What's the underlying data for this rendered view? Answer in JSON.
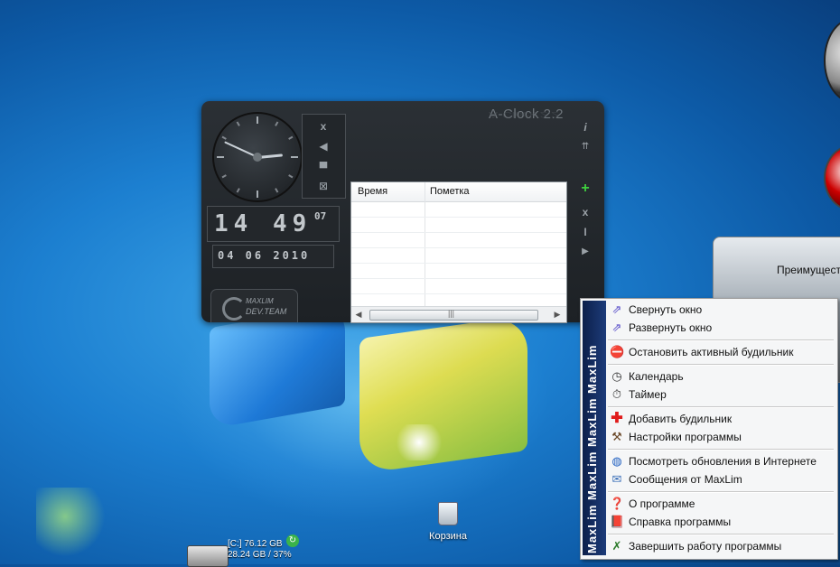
{
  "desktop": {
    "recycle_bin_label": "Корзина",
    "drive_line1": "[C:] 76.12 GB",
    "drive_line2": "28.24 GB / 37%",
    "promo_text": "Преимущест"
  },
  "aclock": {
    "title": "A-Clock 2.2",
    "analog": {
      "hour": 14,
      "minute": 49,
      "second": 7
    },
    "time_display": "14 49",
    "seconds_display": "07",
    "date_display": "04 06 2010",
    "logo_line1": "MAXLIM",
    "logo_line2": "DEV.TEAM",
    "ctrl_icons": [
      "close-icon",
      "back-icon",
      "minimize-icon",
      "resize-icon"
    ],
    "side_icons": [
      "info-icon",
      "pin-icon",
      "add-icon",
      "delete-icon",
      "edit-icon",
      "play-icon"
    ],
    "list": {
      "columns": [
        "Время",
        "Пометка"
      ],
      "rows": 7
    }
  },
  "menu": {
    "brand": "MaxLim  MaxLim  MaxLim  MaxLim",
    "items": [
      {
        "label": "Свернуть окно",
        "icon": "minimize-window-icon",
        "color": "#5a4fc9"
      },
      {
        "label": "Развернуть окно",
        "icon": "restore-window-icon",
        "color": "#5a4fc9"
      },
      {
        "label": "Остановить активный будильник",
        "icon": "stop-alarm-icon",
        "color": "#d42020"
      },
      {
        "label": "Календарь",
        "icon": "calendar-icon",
        "color": "#333333"
      },
      {
        "label": "Таймер",
        "icon": "timer-icon",
        "color": "#333333"
      },
      {
        "label": "Добавить будильник",
        "icon": "add-alarm-icon",
        "color": "#e01b1b"
      },
      {
        "label": "Настройки программы",
        "icon": "settings-icon",
        "color": "#6b4a2a"
      },
      {
        "label": "Посмотреть обновления в Интернете",
        "icon": "globe-icon",
        "color": "#1f5fc0"
      },
      {
        "label": "Сообщения от MaxLim",
        "icon": "messages-icon",
        "color": "#3b6fb8"
      },
      {
        "label": "О программе",
        "icon": "help-icon",
        "color": "#1e8f2a"
      },
      {
        "label": "Справка программы",
        "icon": "book-icon",
        "color": "#7a2a8a"
      },
      {
        "label": "Завершить работу программы",
        "icon": "exit-icon",
        "color": "#2a7a2a"
      }
    ]
  }
}
